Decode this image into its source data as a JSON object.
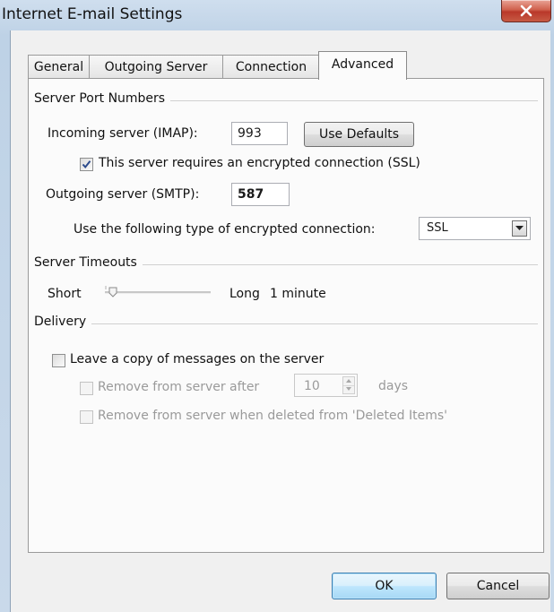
{
  "window": {
    "title": "Internet E-mail Settings",
    "close_label": "X"
  },
  "tabs": [
    {
      "label": "General",
      "active": false
    },
    {
      "label": "Outgoing Server",
      "active": false
    },
    {
      "label": "Connection",
      "active": false
    },
    {
      "label": "Advanced",
      "active": true
    }
  ],
  "server_ports": {
    "group_label": "Server Port Numbers",
    "incoming_label": "Incoming server (IMAP):",
    "incoming_value": "993",
    "use_defaults_label": "Use Defaults",
    "incoming_ssl_label": "This server requires an encrypted connection (SSL)",
    "incoming_ssl_checked": true,
    "outgoing_label": "Outgoing server (SMTP):",
    "outgoing_value": "587",
    "encryption_label": "Use the following type of encrypted connection:",
    "encryption_value": "SSL"
  },
  "timeouts": {
    "group_label": "Server Timeouts",
    "short_label": "Short",
    "long_label": "Long",
    "value_label": "1 minute",
    "slider_level": 0.05
  },
  "delivery": {
    "group_label": "Delivery",
    "leave_copy_label": "Leave a copy of messages on the server",
    "leave_copy_checked": false,
    "remove_after_label": "Remove from server after",
    "remove_after_days": "10",
    "days_label": "days",
    "remove_deleted_label": "Remove from server when deleted from 'Deleted Items'"
  },
  "buttons": {
    "ok_label": "OK",
    "cancel_label": "Cancel"
  },
  "colors": {
    "accent": "#3c7fb1",
    "close": "#c75a44"
  }
}
